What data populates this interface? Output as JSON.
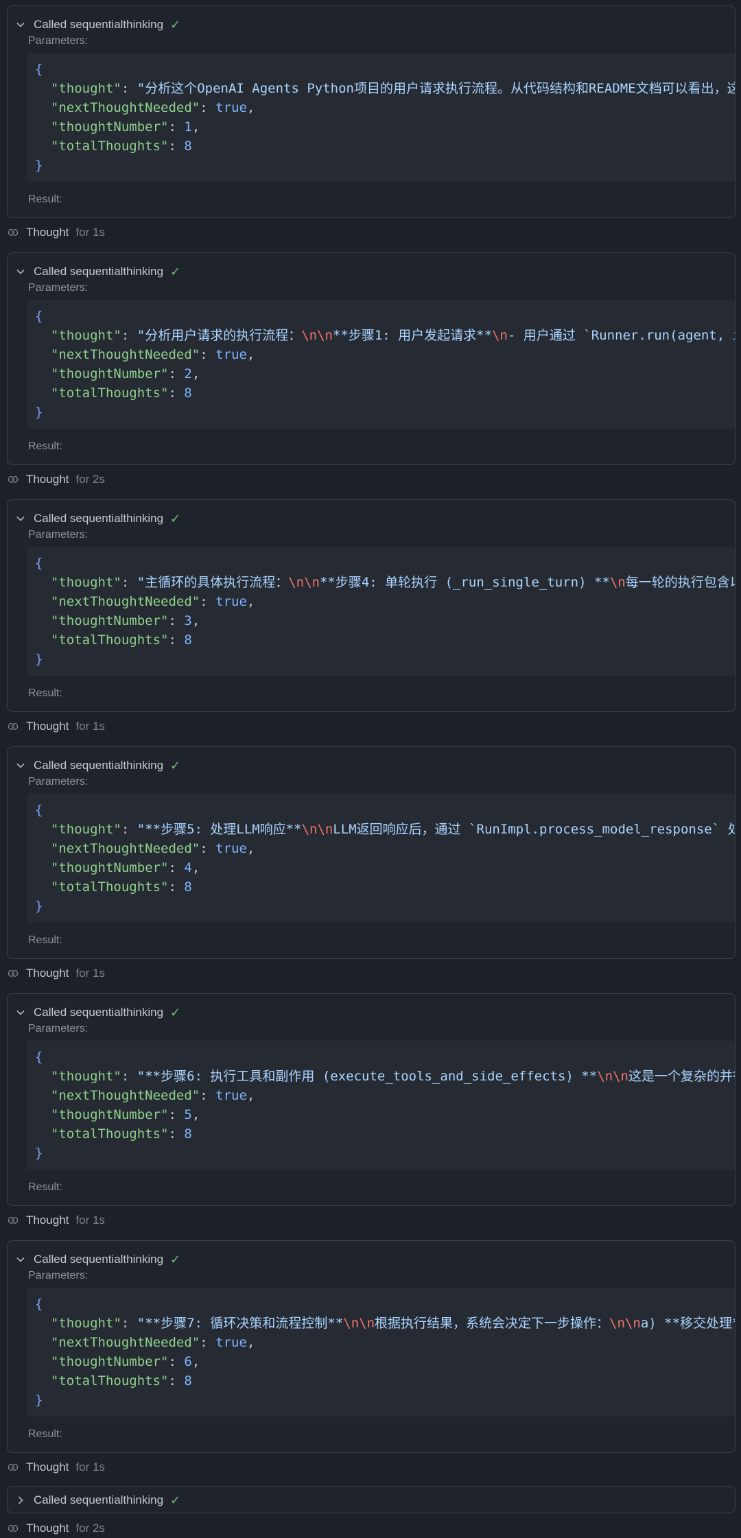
{
  "blocks": [
    {
      "title": "Called sequentialthinking",
      "params_label": "Parameters:",
      "result_label": "Result:",
      "thought_text": "分析这个OpenAI Agents Python项目的用户请求执行流程。从代码结构和README文档可以看出，这",
      "thought_parts": [
        {
          "t": "分析这个OpenAI Agents Python项目的用户请求执行流程。从代码结构和README文档可以看出，这",
          "esc": false
        }
      ],
      "nextThoughtNeeded": "true",
      "thoughtNumber": "1",
      "totalThoughts": "8"
    },
    {
      "title": "Called sequentialthinking",
      "params_label": "Parameters:",
      "result_label": "Result:",
      "thought_parts": [
        {
          "t": "分析用户请求的执行流程：",
          "esc": false
        },
        {
          "t": "\\n\\n",
          "esc": true
        },
        {
          "t": "**步骤1: 用户发起请求**",
          "esc": false
        },
        {
          "t": "\\n",
          "esc": true
        },
        {
          "t": "- 用户通过 `Runner.run(agent, i",
          "esc": false
        }
      ],
      "nextThoughtNeeded": "true",
      "thoughtNumber": "2",
      "totalThoughts": "8"
    },
    {
      "title": "Called sequentialthinking",
      "params_label": "Parameters:",
      "result_label": "Result:",
      "thought_parts": [
        {
          "t": "主循环的具体执行流程：",
          "esc": false
        },
        {
          "t": "\\n\\n",
          "esc": true
        },
        {
          "t": "**步骤4: 单轮执行 (_run_single_turn) **",
          "esc": false
        },
        {
          "t": "\\n",
          "esc": true
        },
        {
          "t": "每一轮的执行包含以",
          "esc": false
        }
      ],
      "nextThoughtNeeded": "true",
      "thoughtNumber": "3",
      "totalThoughts": "8"
    },
    {
      "title": "Called sequentialthinking",
      "params_label": "Parameters:",
      "result_label": "Result:",
      "thought_parts": [
        {
          "t": "**步骤5: 处理LLM响应**",
          "esc": false
        },
        {
          "t": "\\n\\n",
          "esc": true
        },
        {
          "t": "LLM返回响应后，通过 `RunImpl.process_model_response` 处",
          "esc": false
        }
      ],
      "nextThoughtNeeded": "true",
      "thoughtNumber": "4",
      "totalThoughts": "8"
    },
    {
      "title": "Called sequentialthinking",
      "params_label": "Parameters:",
      "result_label": "Result:",
      "thought_parts": [
        {
          "t": "**步骤6: 执行工具和副作用 (execute_tools_and_side_effects) **",
          "esc": false
        },
        {
          "t": "\\n\\n",
          "esc": true
        },
        {
          "t": "这是一个复杂的并行",
          "esc": false
        }
      ],
      "nextThoughtNeeded": "true",
      "thoughtNumber": "5",
      "totalThoughts": "8"
    },
    {
      "title": "Called sequentialthinking",
      "params_label": "Parameters:",
      "result_label": "Result:",
      "thought_parts": [
        {
          "t": "**步骤7: 循环决策和流程控制**",
          "esc": false
        },
        {
          "t": "\\n\\n",
          "esc": true
        },
        {
          "t": "根据执行结果，系统会决定下一步操作：",
          "esc": false
        },
        {
          "t": "\\n\\n",
          "esc": true
        },
        {
          "t": "a) **移交处理*",
          "esc": false
        }
      ],
      "nextThoughtNeeded": "true",
      "thoughtNumber": "6",
      "totalThoughts": "8"
    }
  ],
  "keys": {
    "thought": "\"thought\"",
    "nextThoughtNeeded": "\"nextThoughtNeeded\"",
    "thoughtNumber": "\"thoughtNumber\"",
    "totalThoughts": "\"totalThoughts\""
  },
  "thoughts": [
    {
      "label": "Thought",
      "duration": "for 1s"
    },
    {
      "label": "Thought",
      "duration": "for 2s"
    },
    {
      "label": "Thought",
      "duration": "for 1s"
    },
    {
      "label": "Thought",
      "duration": "for 1s"
    },
    {
      "label": "Thought",
      "duration": "for 1s"
    },
    {
      "label": "Thought",
      "duration": "for 1s"
    },
    {
      "label": "Thought",
      "duration": "for 2s"
    }
  ],
  "collapsed_block": {
    "title": "Called sequentialthinking"
  }
}
